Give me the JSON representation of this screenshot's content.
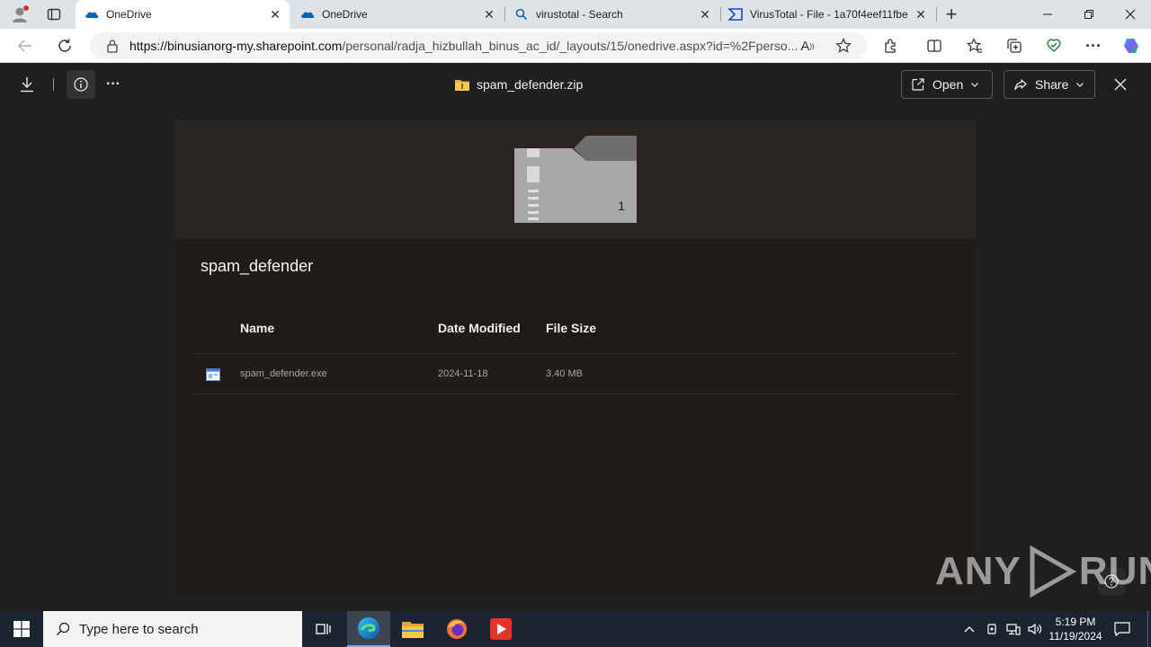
{
  "browser": {
    "tabs": [
      {
        "title": "OneDrive",
        "icon": "onedrive-cloud-icon",
        "active": true
      },
      {
        "title": "OneDrive",
        "icon": "onedrive-cloud-icon",
        "active": false
      },
      {
        "title": "virustotal - Search",
        "icon": "search-icon",
        "active": false
      },
      {
        "title": "VirusTotal - File - 1a70f4eef11fbe",
        "icon": "virustotal-icon",
        "active": false
      }
    ],
    "url_host": "https://binusianorg-my.sharepoint.com",
    "url_path": "/personal/radja_hizbullah_binus_ac_id/_layouts/15/onedrive.aspx?id=%2Fperso..."
  },
  "viewer": {
    "file_title": "spam_defender.zip",
    "open_label": "Open",
    "share_label": "Share",
    "zip_count": "1",
    "folder_name": "spam_defender",
    "columns": {
      "name": "Name",
      "date": "Date Modified",
      "size": "File Size"
    },
    "rows": [
      {
        "name": "spam_defender.exe",
        "date": "2024-11-18",
        "size": "3.40 MB"
      }
    ]
  },
  "watermark": {
    "text_left": "ANY",
    "text_right": "RUN"
  },
  "taskbar": {
    "search_placeholder": "Type here to search",
    "time": "5:19 PM",
    "date": "11/19/2024"
  },
  "colors": {
    "accent": "#0078d4",
    "viewer_bg": "#1f1f1f",
    "card_bg": "#201c1a",
    "taskbar_bg": "#1c2430"
  }
}
